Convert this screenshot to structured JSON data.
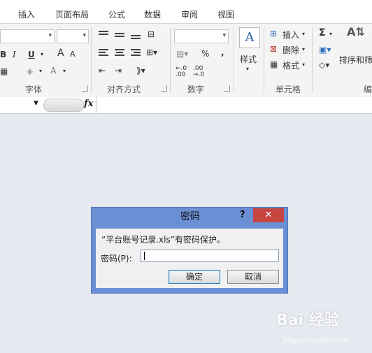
{
  "tabs": [
    "插入",
    "页面布局",
    "公式",
    "数据",
    "审阅",
    "视图"
  ],
  "ribbon": {
    "groups": {
      "font": "字体",
      "alignment": "对齐方式",
      "number": "数字",
      "cells": "单元格",
      "editing": "编"
    },
    "font_buttons": {
      "bold": "B",
      "italic": "I",
      "underline": "U",
      "grow": "A",
      "shrink": "A",
      "color": "A"
    },
    "number": {
      "percent": "%",
      "comma": ",",
      "inc_decimal": "←.0\n.00",
      "dec_decimal": ".00\n→.0"
    },
    "styles_label": "样式",
    "cells_items": [
      "插入",
      "删除",
      "格式"
    ],
    "editing": {
      "sum": "Σ",
      "sort_filter": "排序和筛"
    }
  },
  "formula_bar": {
    "fx": "fx",
    "value": ""
  },
  "dialog": {
    "title": "密码",
    "help": "?",
    "close": "✕",
    "message": "“平台账号记录.xls”有密码保护。",
    "password_label": "密码(P):",
    "password_value": "",
    "ok": "确定",
    "cancel": "取消"
  },
  "watermark": {
    "text": "Bai 经验",
    "sub": "jingyan.baidu.com"
  }
}
